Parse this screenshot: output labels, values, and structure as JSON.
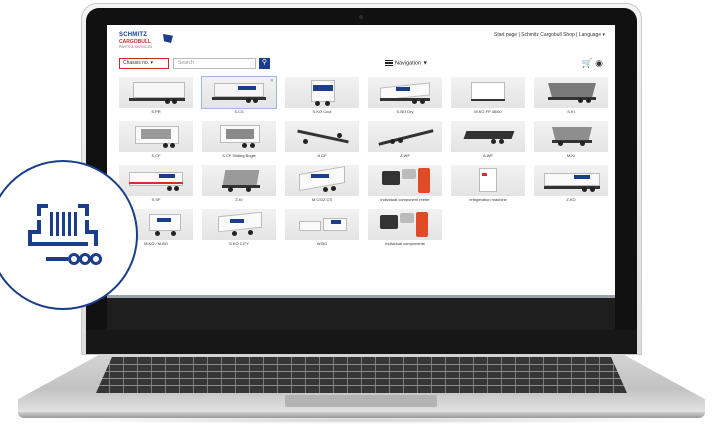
{
  "header": {
    "logo_line1": "SCHMITZ",
    "logo_line2": "CARGOBULL",
    "logo_line3": "PARTS & SERVICES",
    "top_links": "Start page | Schmitz Cargobull Shop | Language ▾"
  },
  "search": {
    "dropdown_label": "Chassis no. ▾",
    "placeholder": "Search",
    "button_icon": "search-icon"
  },
  "nav": {
    "label": "Navigation",
    "chevron": "▼"
  },
  "right_icons": [
    "cart-icon",
    "user-icon"
  ],
  "products": [
    {
      "label": "S.PR"
    },
    {
      "label": "S.CS",
      "selected": true
    },
    {
      "label": "S.KO Cool"
    },
    {
      "label": "S.BO Dry"
    },
    {
      "label": "M.KO FP 45/60"
    },
    {
      "label": "S.KI"
    },
    {
      "label": "S.CF"
    },
    {
      "label": "S.CF Sliding Bogie"
    },
    {
      "label": "A.CF"
    },
    {
      "label": "Z.WF"
    },
    {
      "label": "A.WF"
    },
    {
      "label": "M.KI"
    },
    {
      "label": "S.SF"
    },
    {
      "label": "Z.KI"
    },
    {
      "label": "M.CS/Z.CS"
    },
    {
      "label": "Individual component reefer"
    },
    {
      "label": "refrigeration machine"
    },
    {
      "label": "Z.KO"
    },
    {
      "label": "M.KO / M.BO"
    },
    {
      "label": "S.KO CITY"
    },
    {
      "label": "W.BO"
    },
    {
      "label": "Individual components"
    }
  ],
  "badge": {
    "icon": "barcode-scanner-icon",
    "color": "#1a3e8c"
  },
  "colors": {
    "brand_blue": "#1a3e8c",
    "accent_red": "#c62828"
  }
}
